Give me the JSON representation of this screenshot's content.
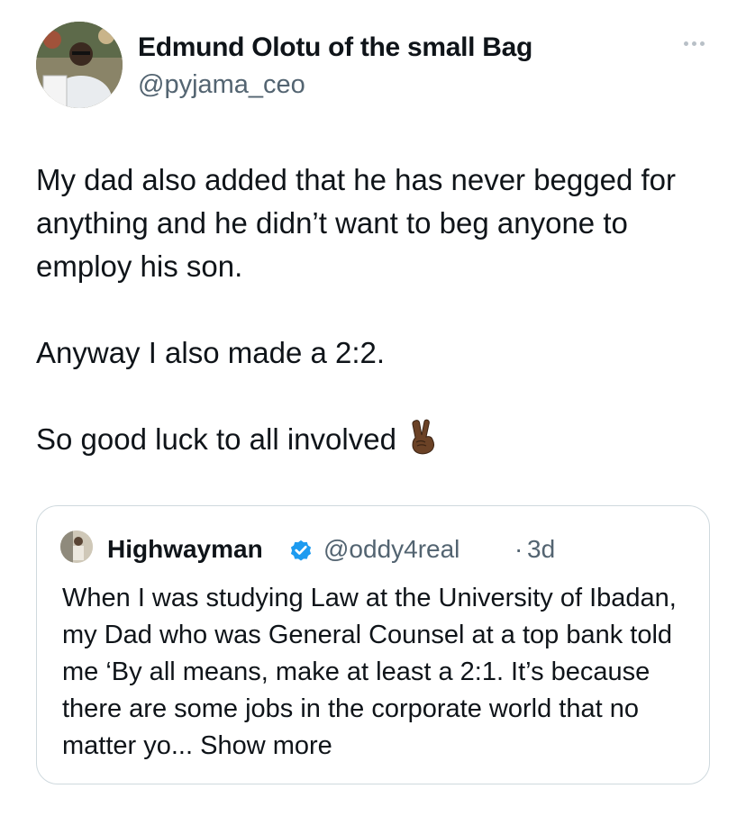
{
  "author": {
    "name": "Edmund Olotu of the small Bag",
    "handle": "@pyjama_ceo",
    "avatar_icon": "user-avatar-photo"
  },
  "more_icon": "more-horizontal-icon",
  "tweet": {
    "paragraphs": [
      "My dad also added that he has never begged for anything and he didn’t want to beg anyone to employ his son.",
      "Anyway I also made a 2:2.",
      "So good luck to all involved"
    ],
    "emoji": "victory-hand-emoji"
  },
  "quote": {
    "name": "Highwayman",
    "verified": true,
    "verified_color": "#1d9bf0",
    "handle": "@oddy4real",
    "separator": "·",
    "time": "3d",
    "text": "When I was studying Law at the University of Ibadan, my Dad who was General Counsel at a top bank told me ‘By all means, make at least a 2:1. It’s because there are some jobs in the corporate world that no matter yo...",
    "show_more": "Show more"
  },
  "colors": {
    "text": "#0f1419",
    "secondary": "#536471",
    "border": "#cfd9de"
  }
}
